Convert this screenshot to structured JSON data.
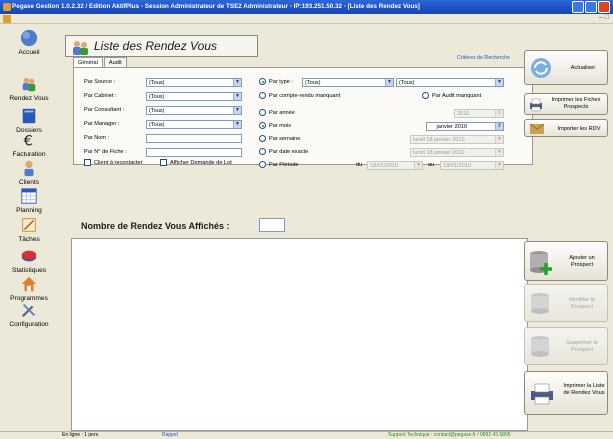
{
  "window": {
    "title": "Pegase Gestion 1.0.2.32 / Edition AktifPlus - Session Administrateur de TSE2 Administrateur - IP:193.251.50.32 - [Liste des Rendez Vous]"
  },
  "sidebar": {
    "items": [
      {
        "label": "Accueil",
        "icon": "globe-icon"
      },
      {
        "label": "Rendez Vous",
        "icon": "people-icon"
      },
      {
        "label": "Dossiers",
        "icon": "folder-icon"
      },
      {
        "label": "Facturation",
        "icon": "euro-icon"
      },
      {
        "label": "Clients",
        "icon": "person-icon"
      },
      {
        "label": "Planning",
        "icon": "calendar-icon"
      },
      {
        "label": "Tâches",
        "icon": "tasks-icon"
      },
      {
        "label": "Statistiques",
        "icon": "stats-icon"
      },
      {
        "label": "Programmes",
        "icon": "house-icon"
      },
      {
        "label": "Configuration",
        "icon": "tools-icon"
      }
    ]
  },
  "header": {
    "title": "Liste des Rendez Vous",
    "criteria_label": "Critères de Recherche"
  },
  "tabs": [
    "Général",
    "Audit"
  ],
  "filters": {
    "source": {
      "label": "Par Source :",
      "value": "(Tous)"
    },
    "cabinet": {
      "label": "Par Cabinet :",
      "value": "(Tous)"
    },
    "consultant": {
      "label": "Par Consultant :",
      "value": "(Tous)"
    },
    "manager": {
      "label": "Par Manager :",
      "value": "(Tous)"
    },
    "nom": {
      "label": "Par Nom :"
    },
    "fiche": {
      "label": "Par N° de Fiche :"
    },
    "client_recontacter": "Client à recontacter",
    "afficher_demande": "Afficher Demande de Lot"
  },
  "options": {
    "par_type": {
      "label": "Par type :",
      "value1": "(Tous)",
      "value2": "(Tous)"
    },
    "par_cr_manquant": "Par compte-rendu manquant",
    "par_audit_manquant": "Par Audit manquant",
    "par_annee": {
      "label": "Par année",
      "value": "2010"
    },
    "par_mois": {
      "label": "Par mois",
      "month": "janvier",
      "year": "2010"
    },
    "par_semaine": {
      "label": "Par semaine",
      "value": "lundi   18   janvier   2010"
    },
    "par_date_exacte": {
      "label": "Par date exacte",
      "value": "lundi   18   janvier   2010"
    },
    "par_periode": {
      "label": "Par Période",
      "du_label": "du",
      "du_value": "18/01/2010",
      "au_label": "au",
      "au_value": "18/01/2010"
    }
  },
  "count": {
    "label": "Nombre de Rendez Vous Affichés :",
    "value": ""
  },
  "right_buttons": {
    "actualiser": "Actualiser",
    "imprimer_fiches": "Imprimer les Fiches Prospects",
    "importer_rdv": "Importer les RDV",
    "ajouter": "Ajouter un Prospect",
    "modifier": "Modifier le Prospect",
    "supprimer": "Supprimer le Prospect",
    "imprimer_liste": "Imprimer la Liste de Rendez Vous"
  },
  "status": {
    "left": "En ligne : 1 pers.",
    "mid": "Rappel",
    "right": "Support Technique : contact@pegase.fr / 0892 43 6895"
  },
  "colors": {
    "titlebar": "#1c4fc0",
    "link": "#2a5ab8",
    "status_text": "#2c8c2c"
  }
}
